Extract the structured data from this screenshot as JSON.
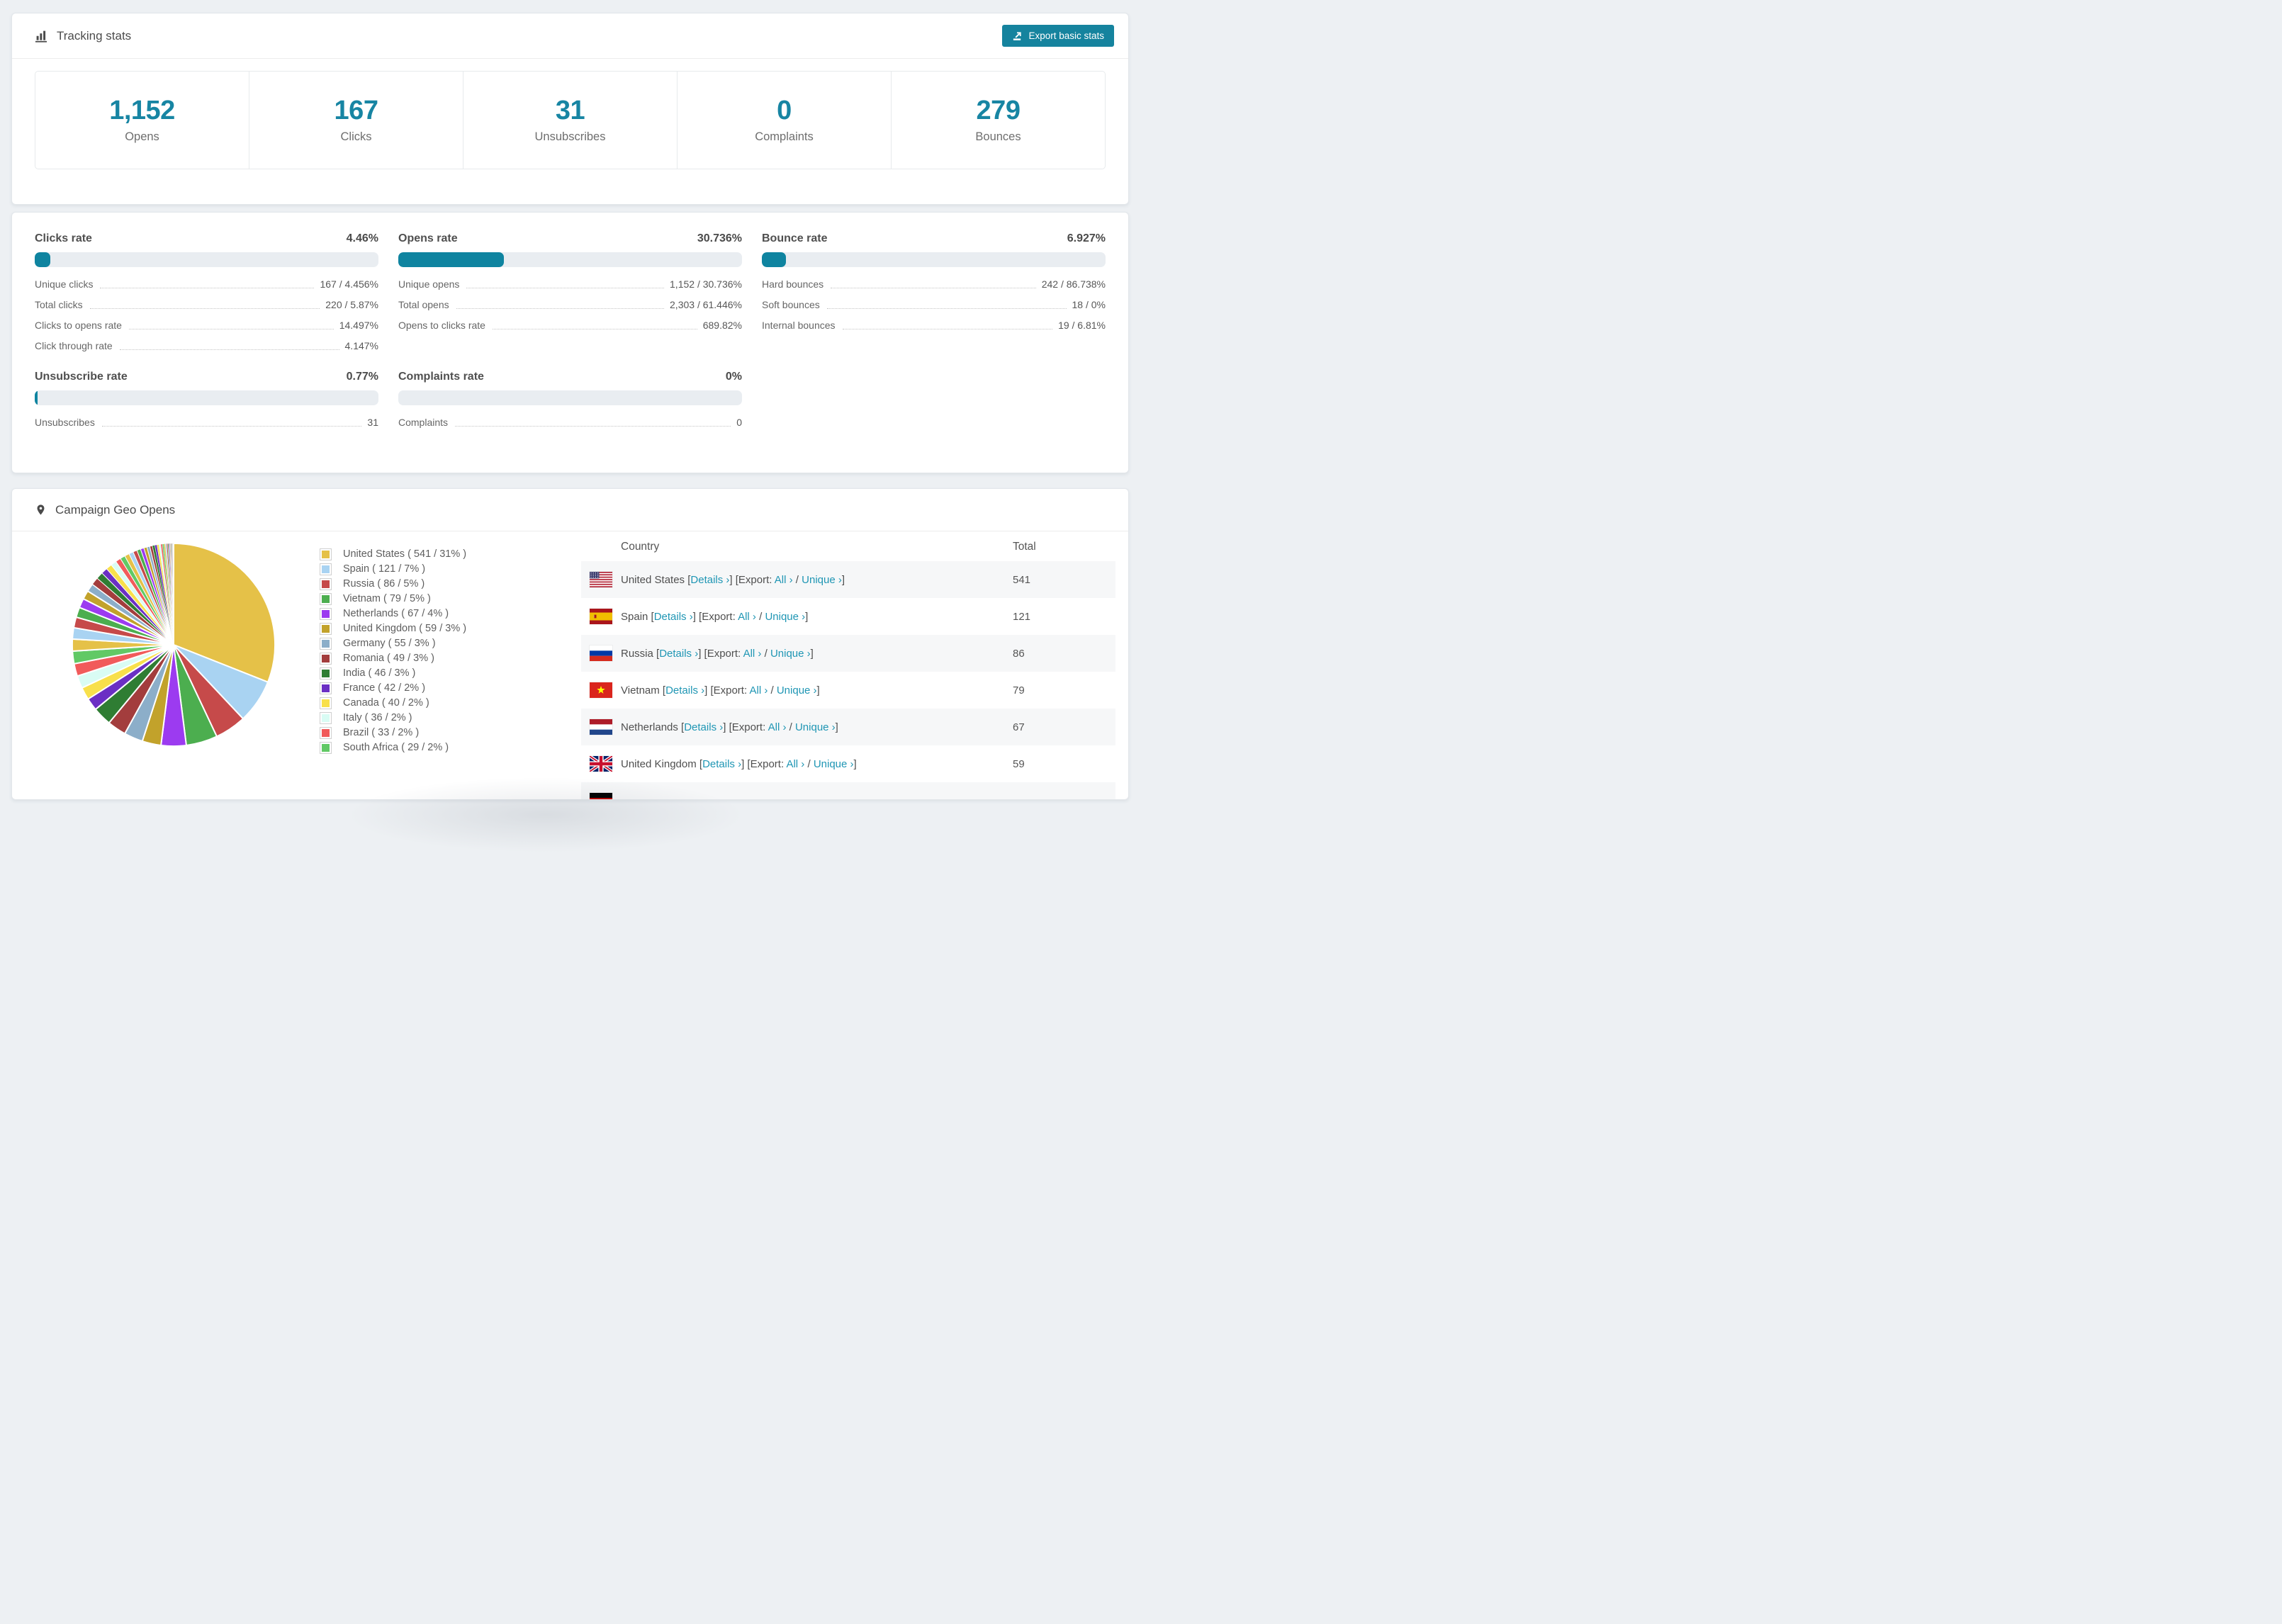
{
  "colors": {
    "accent_teal": "#1785a3",
    "button_teal": "#15839e",
    "bar_fill": "#0f84a0",
    "bar_track": "#e9edf1",
    "link_teal": "#1f96b4"
  },
  "tracking": {
    "title": "Tracking stats",
    "export_button": "Export basic stats",
    "stats": [
      {
        "value": "1,152",
        "label": "Opens"
      },
      {
        "value": "167",
        "label": "Clicks"
      },
      {
        "value": "31",
        "label": "Unsubscribes"
      },
      {
        "value": "0",
        "label": "Complaints"
      },
      {
        "value": "279",
        "label": "Bounces"
      }
    ]
  },
  "rates": [
    {
      "title": "Clicks rate",
      "value": "4.46%",
      "pct": 4.46,
      "rows": [
        {
          "label": "Unique clicks",
          "value": "167 / 4.456%"
        },
        {
          "label": "Total clicks",
          "value": "220 / 5.87%"
        },
        {
          "label": "Clicks to opens rate",
          "value": "14.497%"
        },
        {
          "label": "Click through rate",
          "value": "4.147%"
        }
      ]
    },
    {
      "title": "Opens rate",
      "value": "30.736%",
      "pct": 30.736,
      "rows": [
        {
          "label": "Unique opens",
          "value": "1,152 / 30.736%"
        },
        {
          "label": "Total opens",
          "value": "2,303 / 61.446%"
        },
        {
          "label": "Opens to clicks rate",
          "value": "689.82%"
        }
      ]
    },
    {
      "title": "Bounce rate",
      "value": "6.927%",
      "pct": 6.927,
      "rows": [
        {
          "label": "Hard bounces",
          "value": "242 / 86.738%"
        },
        {
          "label": "Soft bounces",
          "value": "18 / 0%"
        },
        {
          "label": "Internal bounces",
          "value": "19 / 6.81%"
        }
      ]
    },
    {
      "title": "Unsubscribe rate",
      "value": "0.77%",
      "pct": 0.77,
      "rows": [
        {
          "label": "Unsubscribes",
          "value": "31"
        }
      ]
    },
    {
      "title": "Complaints rate",
      "value": "0%",
      "pct": 0,
      "rows": [
        {
          "label": "Complaints",
          "value": "0"
        }
      ]
    }
  ],
  "geo": {
    "title": "Campaign Geo Opens",
    "chart_data": {
      "type": "pie",
      "title": "Campaign Geo Opens",
      "legend_position": "right",
      "series": [
        {
          "name": "United States",
          "value": 541,
          "pct": 31,
          "color": "#e5c148"
        },
        {
          "name": "Spain",
          "value": 121,
          "pct": 7,
          "color": "#a9d3f2"
        },
        {
          "name": "Russia",
          "value": 86,
          "pct": 5,
          "color": "#c64a4a"
        },
        {
          "name": "Vietnam",
          "value": 79,
          "pct": 5,
          "color": "#4cae4f"
        },
        {
          "name": "Netherlands",
          "value": 67,
          "pct": 4,
          "color": "#9c3bf0"
        },
        {
          "name": "United Kingdom",
          "value": 59,
          "pct": 3,
          "color": "#c2a22b"
        },
        {
          "name": "Germany",
          "value": 55,
          "pct": 3,
          "color": "#8caec9"
        },
        {
          "name": "Romania",
          "value": 49,
          "pct": 3,
          "color": "#a33d3d"
        },
        {
          "name": "India",
          "value": 46,
          "pct": 3,
          "color": "#2f7d33"
        },
        {
          "name": "France",
          "value": 42,
          "pct": 2,
          "color": "#6b2fc4"
        },
        {
          "name": "Canada",
          "value": 40,
          "pct": 2,
          "color": "#f8e04b"
        },
        {
          "name": "Italy",
          "value": 36,
          "pct": 2,
          "color": "#d9fcf4"
        },
        {
          "name": "Brazil",
          "value": 33,
          "pct": 2,
          "color": "#f15b5b"
        },
        {
          "name": "South Africa",
          "value": 29,
          "pct": 2,
          "color": "#61c965"
        }
      ],
      "others_tail_pct": [
        1.9,
        1.8,
        1.7,
        1.6,
        1.5,
        1.4,
        1.3,
        1.2,
        1.1,
        1.0,
        0.95,
        0.9,
        0.85,
        0.8,
        0.75,
        0.7,
        0.65,
        0.6,
        0.55,
        0.5,
        0.46,
        0.42,
        0.38,
        0.35,
        0.32,
        0.29,
        0.26,
        0.24,
        0.22,
        0.2,
        0.18,
        0.16,
        0.14,
        0.12,
        0.11,
        0.1,
        0.09,
        0.08,
        0.07,
        0.06
      ]
    },
    "legend_labels": [
      "United States ( 541 / 31% )",
      "Spain ( 121 / 7% )",
      "Russia ( 86 / 5% )",
      "Vietnam ( 79 / 5% )",
      "Netherlands ( 67 / 4% )",
      "United Kingdom ( 59 / 3% )",
      "Germany ( 55 / 3% )",
      "Romania ( 49 / 3% )",
      "India ( 46 / 3% )",
      "France ( 42 / 2% )",
      "Canada ( 40 / 2% )",
      "Italy ( 36 / 2% )",
      "Brazil ( 33 / 2% )",
      "South Africa ( 29 / 2% )"
    ],
    "table": {
      "col_country": "Country",
      "col_total": "Total",
      "open_bracket": "[",
      "close_bracket": "]",
      "details_label": "Details ›",
      "export_label": "Export:",
      "all_label": "All ›",
      "separator": "/",
      "unique_label": "Unique ›",
      "rows": [
        {
          "country": "United States",
          "total": "541",
          "flag": "us",
          "partial": false
        },
        {
          "country": "Spain",
          "total": "121",
          "flag": "es",
          "partial": false
        },
        {
          "country": "Russia",
          "total": "86",
          "flag": "ru",
          "partial": false
        },
        {
          "country": "Vietnam",
          "total": "79",
          "flag": "vn",
          "partial": false
        },
        {
          "country": "Netherlands",
          "total": "67",
          "flag": "nl",
          "partial": false
        },
        {
          "country": "United Kingdom",
          "total": "59",
          "flag": "gb",
          "partial": false
        },
        {
          "country": "",
          "total": "",
          "flag": "de",
          "partial": true
        }
      ]
    }
  }
}
